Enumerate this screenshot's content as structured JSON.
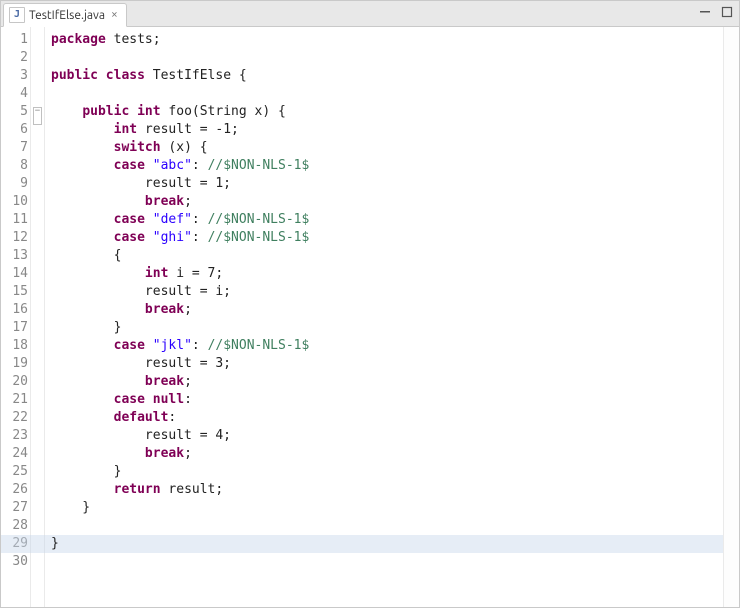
{
  "tab": {
    "label": "TestIfElse.java"
  },
  "toolbar": {
    "minimize": "minimize-icon",
    "maximize": "maximize-icon"
  },
  "highlight_line_index": 28,
  "code": [
    {
      "n": 1,
      "tokens": [
        [
          "kw",
          "package"
        ],
        [
          "",
          " tests;"
        ]
      ]
    },
    {
      "n": 2,
      "tokens": [
        [
          "",
          ""
        ]
      ]
    },
    {
      "n": 3,
      "tokens": [
        [
          "kw",
          "public"
        ],
        [
          "",
          " "
        ],
        [
          "kw",
          "class"
        ],
        [
          "",
          " TestIfElse {"
        ]
      ]
    },
    {
      "n": 4,
      "tokens": [
        [
          "",
          ""
        ]
      ]
    },
    {
      "n": 5,
      "marker": "collapse",
      "tokens": [
        [
          "",
          "    "
        ],
        [
          "kw",
          "public"
        ],
        [
          "",
          " "
        ],
        [
          "kw",
          "int"
        ],
        [
          "",
          " foo(String x) {"
        ]
      ]
    },
    {
      "n": 6,
      "tokens": [
        [
          "",
          "        "
        ],
        [
          "kw",
          "int"
        ],
        [
          "",
          " result = -1;"
        ]
      ]
    },
    {
      "n": 7,
      "tokens": [
        [
          "",
          "        "
        ],
        [
          "kw",
          "switch"
        ],
        [
          "",
          " (x) {"
        ]
      ]
    },
    {
      "n": 8,
      "tokens": [
        [
          "",
          "        "
        ],
        [
          "kw",
          "case"
        ],
        [
          "",
          " "
        ],
        [
          "str",
          "\"abc\""
        ],
        [
          "",
          ": "
        ],
        [
          "cmt",
          "//$NON-NLS-1$"
        ]
      ]
    },
    {
      "n": 9,
      "tokens": [
        [
          "",
          "            result = 1;"
        ]
      ]
    },
    {
      "n": 10,
      "tokens": [
        [
          "",
          "            "
        ],
        [
          "kw",
          "break"
        ],
        [
          "",
          ";"
        ]
      ]
    },
    {
      "n": 11,
      "tokens": [
        [
          "",
          "        "
        ],
        [
          "kw",
          "case"
        ],
        [
          "",
          " "
        ],
        [
          "str",
          "\"def\""
        ],
        [
          "",
          ": "
        ],
        [
          "cmt",
          "//$NON-NLS-1$"
        ]
      ]
    },
    {
      "n": 12,
      "tokens": [
        [
          "",
          "        "
        ],
        [
          "kw",
          "case"
        ],
        [
          "",
          " "
        ],
        [
          "str",
          "\"ghi\""
        ],
        [
          "",
          ": "
        ],
        [
          "cmt",
          "//$NON-NLS-1$"
        ]
      ]
    },
    {
      "n": 13,
      "tokens": [
        [
          "",
          "        {"
        ]
      ]
    },
    {
      "n": 14,
      "tokens": [
        [
          "",
          "            "
        ],
        [
          "kw",
          "int"
        ],
        [
          "",
          " i = 7;"
        ]
      ]
    },
    {
      "n": 15,
      "tokens": [
        [
          "",
          "            result = i;"
        ]
      ]
    },
    {
      "n": 16,
      "tokens": [
        [
          "",
          "            "
        ],
        [
          "kw",
          "break"
        ],
        [
          "",
          ";"
        ]
      ]
    },
    {
      "n": 17,
      "tokens": [
        [
          "",
          "        }"
        ]
      ]
    },
    {
      "n": 18,
      "tokens": [
        [
          "",
          "        "
        ],
        [
          "kw",
          "case"
        ],
        [
          "",
          " "
        ],
        [
          "str",
          "\"jkl\""
        ],
        [
          "",
          ": "
        ],
        [
          "cmt",
          "//$NON-NLS-1$"
        ]
      ]
    },
    {
      "n": 19,
      "tokens": [
        [
          "",
          "            result = 3;"
        ]
      ]
    },
    {
      "n": 20,
      "tokens": [
        [
          "",
          "            "
        ],
        [
          "kw",
          "break"
        ],
        [
          "",
          ";"
        ]
      ]
    },
    {
      "n": 21,
      "tokens": [
        [
          "",
          "        "
        ],
        [
          "kw",
          "case"
        ],
        [
          "",
          " "
        ],
        [
          "kw",
          "null"
        ],
        [
          "",
          ":"
        ]
      ]
    },
    {
      "n": 22,
      "tokens": [
        [
          "",
          "        "
        ],
        [
          "kw",
          "default"
        ],
        [
          "",
          ":"
        ]
      ]
    },
    {
      "n": 23,
      "tokens": [
        [
          "",
          "            result = 4;"
        ]
      ]
    },
    {
      "n": 24,
      "tokens": [
        [
          "",
          "            "
        ],
        [
          "kw",
          "break"
        ],
        [
          "",
          ";"
        ]
      ]
    },
    {
      "n": 25,
      "tokens": [
        [
          "",
          "        }"
        ]
      ]
    },
    {
      "n": 26,
      "tokens": [
        [
          "",
          "        "
        ],
        [
          "kw",
          "return"
        ],
        [
          "",
          " result;"
        ]
      ]
    },
    {
      "n": 27,
      "tokens": [
        [
          "",
          "    }"
        ]
      ]
    },
    {
      "n": 28,
      "tokens": [
        [
          "",
          ""
        ]
      ]
    },
    {
      "n": 29,
      "tokens": [
        [
          "",
          "}"
        ]
      ]
    },
    {
      "n": 30,
      "tokens": [
        [
          "",
          ""
        ]
      ]
    }
  ]
}
